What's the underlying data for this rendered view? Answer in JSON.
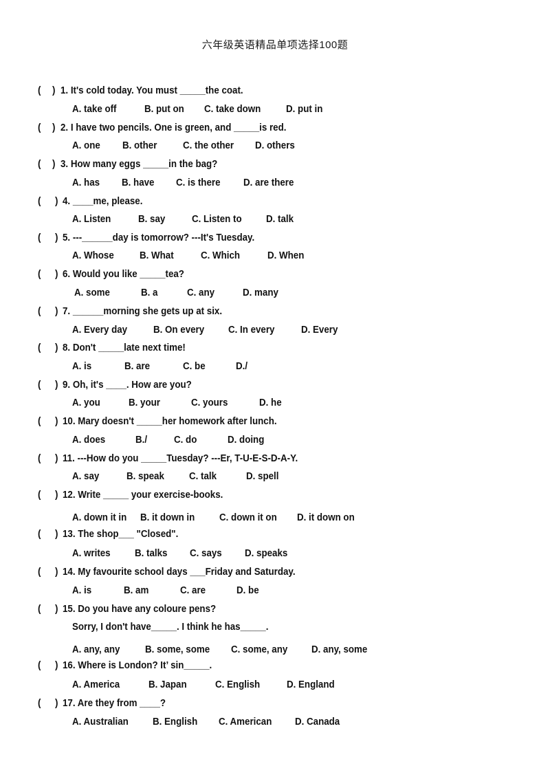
{
  "document": {
    "title": "六年级英语精品单项选择100题",
    "questions": [
      {
        "number": "1.",
        "stem": "It's cold today. You must _____the coat.",
        "options": [
          "A. take off",
          "B. put on",
          "C. take down",
          "D. put in"
        ]
      },
      {
        "number": "2.",
        "stem": "I have two pencils. One is green, and _____is red.",
        "options": [
          "A. one",
          "B. other",
          "C. the other",
          "D. others"
        ]
      },
      {
        "number": "3.",
        "stem": "How many eggs _____in the bag?",
        "options": [
          "A. has",
          "B. have",
          "C. is there",
          "D. are there"
        ]
      },
      {
        "number": "4.",
        "stem": "____me, please.",
        "options": [
          "A. Listen",
          "B. say",
          "C. Listen to",
          "D. talk"
        ]
      },
      {
        "number": "5.",
        "stem": "---______day is tomorrow? ---It's Tuesday.",
        "options": [
          "A. Whose",
          "B. What",
          "C. Which",
          "D. When"
        ]
      },
      {
        "number": "6.",
        "stem": "Would you like _____tea?",
        "options": [
          "A. some",
          "B. a",
          "C. any",
          "D. many"
        ]
      },
      {
        "number": "7.",
        "stem": "______morning she gets up at six.",
        "options": [
          "A. Every day",
          "B. On every",
          "C. In every",
          "D. Every"
        ]
      },
      {
        "number": "8.",
        "stem": "Don't _____late next time!",
        "options": [
          "A. is",
          "B. are",
          "C. be",
          "D./"
        ]
      },
      {
        "number": "9.",
        "stem": "Oh, it's ____. How are you?",
        "options": [
          "A. you",
          "B. your",
          "C. yours",
          "D. he"
        ]
      },
      {
        "number": "10.",
        "stem": "Mary doesn't _____her homework after lunch.",
        "options": [
          "A. does",
          "B./",
          "C. do",
          "D. doing"
        ]
      },
      {
        "number": "11.",
        "stem": "---How do you _____Tuesday? ---Er, T-U-E-S-D-A-Y.",
        "options": [
          "A. say",
          "B. speak",
          "C. talk",
          "D. spell"
        ]
      },
      {
        "number": "12.",
        "stem": "Write _____ your exercise-books.",
        "options": [
          "A. down it in",
          "B. it down in",
          "C. down it on",
          "D. it down on"
        ]
      },
      {
        "number": "13.",
        "stem": "The shop___ \"Closed\".",
        "options": [
          "A. writes",
          "B. talks",
          "C. says",
          "D. speaks"
        ]
      },
      {
        "number": "14.",
        "stem": "My favourite school days ___Friday and Saturday.",
        "options": [
          "A. is",
          "B. am",
          "C. are",
          "D. be"
        ]
      },
      {
        "number": "15.",
        "stem": "Do you have any coloure pens?",
        "sub_line": "Sorry, I don't have_____. I think he has_____.",
        "options": [
          "A. any, any",
          "B. some, some",
          "C. some, any",
          "D. any, some"
        ]
      },
      {
        "number": "16.",
        "stem": "Where is London? It’ sin_____.",
        "options": [
          "A. America",
          "B. Japan",
          "C. English",
          "D. England"
        ]
      },
      {
        "number": "17.",
        "stem": "Are they from ____?",
        "options": [
          "A. Australian",
          "B. English",
          "C. American",
          "D. Canada"
        ]
      }
    ],
    "answer_paren_open": "(",
    "answer_paren_close": ")"
  }
}
